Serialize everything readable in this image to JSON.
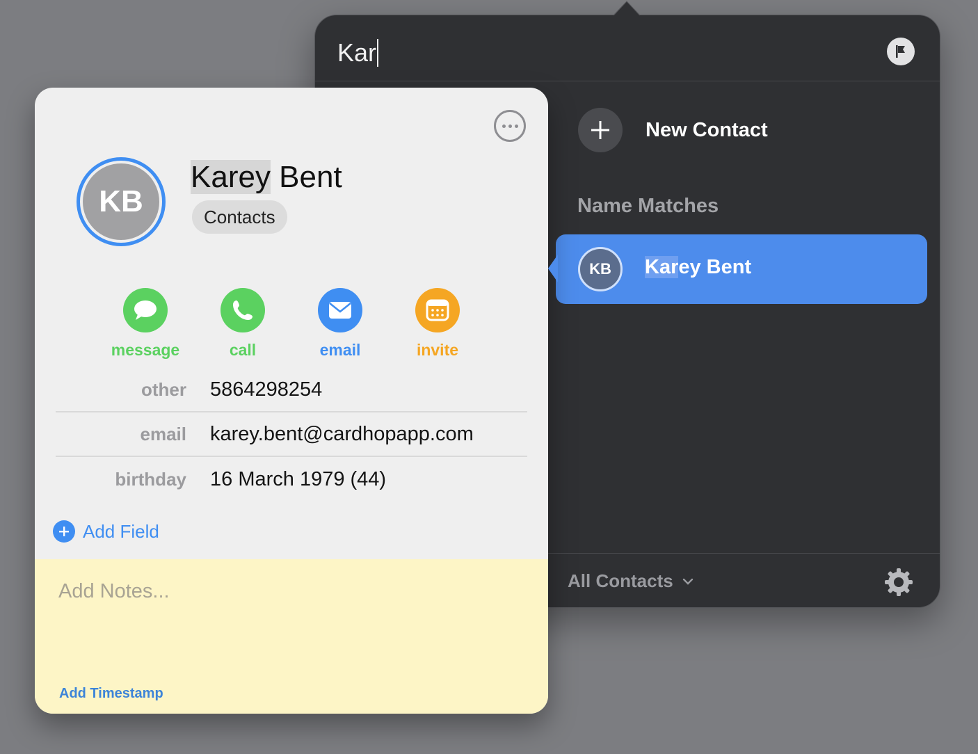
{
  "search": {
    "query": "Kar",
    "flag_icon": "flag-icon"
  },
  "popover": {
    "new_contact_label": "New Contact",
    "section_title": "Name Matches",
    "results": [
      {
        "initials": "KB",
        "name_highlight": "Kar",
        "name_rest": "ey Bent"
      }
    ],
    "footer": {
      "scope_label": "All Contacts",
      "settings_icon": "gear-icon"
    }
  },
  "card": {
    "initials": "KB",
    "name_highlight": "Karey",
    "name_rest": " Bent",
    "group": "Contacts",
    "actions": [
      {
        "label": "message",
        "color": "#5bd160",
        "icon": "message-bubble-icon"
      },
      {
        "label": "call",
        "color": "#5bd160",
        "icon": "phone-icon"
      },
      {
        "label": "email",
        "color": "#3f8ef2",
        "icon": "envelope-icon"
      },
      {
        "label": "invite",
        "color": "#f5a623",
        "icon": "calendar-icon"
      }
    ],
    "fields": [
      {
        "label": "other",
        "value": "5864298254"
      },
      {
        "label": "email",
        "value": "karey.bent@cardhopapp.com"
      },
      {
        "label": "birthday",
        "value": "16 March 1979  (44)"
      }
    ],
    "add_field_label": "Add Field",
    "notes_placeholder": "Add Notes...",
    "timestamp_label": "Add Timestamp"
  },
  "colors": {
    "accent": "#3f8ef2",
    "selection": "#4d8cec",
    "popover_bg": "#2f3033",
    "notes_bg": "#fdf5c6"
  }
}
